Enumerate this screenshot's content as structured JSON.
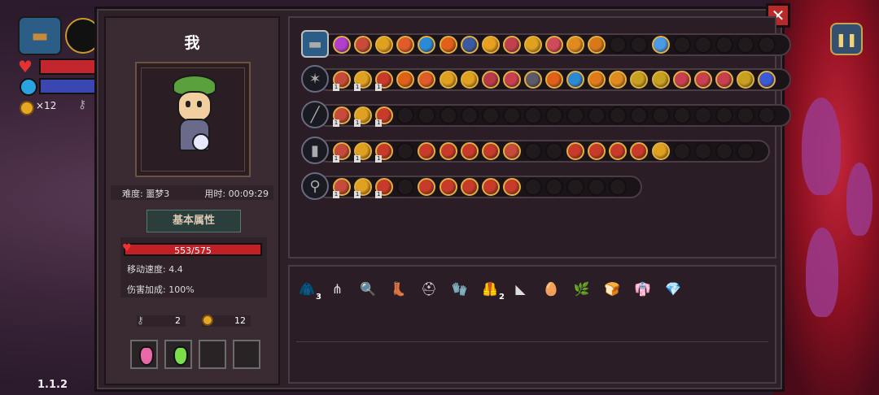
{
  "player": {
    "name": "我"
  },
  "info": {
    "difficulty": "难度: 噩梦3",
    "time": "用时: 00:09:29"
  },
  "attributes": {
    "title": "基本属性",
    "hp": "553/575",
    "hp_fraction": 0.96,
    "move_speed": "移动速度: 4.4",
    "damage_bonus": "伤害加成: 100%"
  },
  "resources": {
    "keys": "2",
    "coins": "12"
  },
  "hud": {
    "coin_count": "×12",
    "version": "1.1.2"
  },
  "potions": [
    {
      "name": "pink-potion",
      "color": "#e868a8"
    },
    {
      "name": "green-potion",
      "color": "#7adf4a"
    }
  ],
  "weapon_rows": [
    {
      "head": "chest",
      "icons": [
        {
          "c": "#b03fcf"
        },
        {
          "c": "#c84a3a"
        },
        {
          "c": "#e0a020"
        },
        {
          "c": "#e05a2a"
        },
        {
          "c": "#2a8ad8"
        },
        {
          "c": "#e0601a"
        },
        {
          "c": "#3a5aa0"
        },
        {
          "c": "#e8a020"
        },
        {
          "c": "#c04050"
        },
        {
          "c": "#e0a020"
        },
        {
          "c": "#d04a5a"
        },
        {
          "c": "#e08a20"
        },
        {
          "c": "#d8781a"
        },
        {
          "c": ""
        },
        {
          "c": ""
        },
        {
          "c": "#4a9ae8"
        },
        {
          "c": ""
        },
        {
          "c": ""
        },
        {
          "c": ""
        },
        {
          "c": ""
        },
        {
          "c": ""
        }
      ]
    },
    {
      "head": "staff",
      "icons": [
        {
          "c": "#c84a3a",
          "l": "1"
        },
        {
          "c": "#e0a020",
          "l": "1"
        },
        {
          "c": "#c83a2a",
          "l": "1"
        },
        {
          "c": "#e0601a"
        },
        {
          "c": "#e05a2a"
        },
        {
          "c": "#e0a020"
        },
        {
          "c": "#e0a020"
        },
        {
          "c": "#b83a4a"
        },
        {
          "c": "#c84050"
        },
        {
          "c": "#5a5a6a"
        },
        {
          "c": "#e0601a"
        },
        {
          "c": "#2a8ad8"
        },
        {
          "c": "#e07a1a"
        },
        {
          "c": "#e08a20"
        },
        {
          "c": "#c8a020"
        },
        {
          "c": "#c8a020"
        },
        {
          "c": "#c84050"
        },
        {
          "c": "#c84050"
        },
        {
          "c": "#c84050"
        },
        {
          "c": "#c8a020"
        },
        {
          "c": "#3a5ad8"
        }
      ]
    },
    {
      "head": "rod",
      "icons": [
        {
          "c": "#c84a3a",
          "l": "1"
        },
        {
          "c": "#e0a020",
          "l": "1"
        },
        {
          "c": "#c83a2a",
          "l": "1"
        },
        {
          "c": ""
        },
        {
          "c": ""
        },
        {
          "c": ""
        },
        {
          "c": ""
        },
        {
          "c": ""
        },
        {
          "c": ""
        },
        {
          "c": ""
        },
        {
          "c": ""
        },
        {
          "c": ""
        },
        {
          "c": ""
        },
        {
          "c": ""
        },
        {
          "c": ""
        },
        {
          "c": ""
        },
        {
          "c": ""
        },
        {
          "c": ""
        },
        {
          "c": ""
        },
        {
          "c": ""
        },
        {
          "c": ""
        }
      ]
    },
    {
      "head": "gauntlet",
      "icons": [
        {
          "c": "#c84a3a",
          "l": "1"
        },
        {
          "c": "#e0a020",
          "l": "1"
        },
        {
          "c": "#c83a2a",
          "l": "1"
        },
        {
          "c": ""
        },
        {
          "c": "#c83a2a"
        },
        {
          "c": "#c83a2a"
        },
        {
          "c": "#c83a2a"
        },
        {
          "c": "#c83a2a"
        },
        {
          "c": "#c84a3a"
        },
        {
          "c": ""
        },
        {
          "c": ""
        },
        {
          "c": "#c83a2a"
        },
        {
          "c": "#c83a2a"
        },
        {
          "c": "#c83a2a"
        },
        {
          "c": "#c83a2a"
        },
        {
          "c": "#e0a020"
        },
        {
          "c": ""
        },
        {
          "c": ""
        },
        {
          "c": ""
        },
        {
          "c": ""
        }
      ]
    },
    {
      "head": "torch",
      "icons": [
        {
          "c": "#c84a3a",
          "l": "1"
        },
        {
          "c": "#e0a020",
          "l": "1"
        },
        {
          "c": "#c83a2a",
          "l": "1"
        },
        {
          "c": ""
        },
        {
          "c": "#c83a2a"
        },
        {
          "c": "#c83a2a"
        },
        {
          "c": "#c83a2a"
        },
        {
          "c": "#c83a2a"
        },
        {
          "c": "#c83a2a"
        },
        {
          "c": ""
        },
        {
          "c": ""
        },
        {
          "c": ""
        },
        {
          "c": ""
        },
        {
          "c": ""
        }
      ]
    }
  ],
  "items": [
    {
      "name": "cloak-item",
      "glyph": "🧥",
      "count": "3"
    },
    {
      "name": "antler-item",
      "glyph": "⋔",
      "count": ""
    },
    {
      "name": "magnifier-item",
      "glyph": "🔍",
      "count": ""
    },
    {
      "name": "boot-item",
      "glyph": "👢",
      "count": ""
    },
    {
      "name": "helmet-item",
      "glyph": "⛑",
      "count": ""
    },
    {
      "name": "gauntlet-item",
      "glyph": "🧤",
      "count": ""
    },
    {
      "name": "armor-item",
      "glyph": "🦺",
      "count": "2"
    },
    {
      "name": "rainbow-cape-item",
      "glyph": "◣",
      "count": ""
    },
    {
      "name": "egg-item",
      "glyph": "🥚",
      "count": ""
    },
    {
      "name": "leaf-item",
      "glyph": "🌿",
      "count": ""
    },
    {
      "name": "bread-item",
      "glyph": "🍞",
      "count": ""
    },
    {
      "name": "robe-item",
      "glyph": "👘",
      "count": ""
    },
    {
      "name": "crystal-item",
      "glyph": "💎",
      "count": ""
    }
  ]
}
